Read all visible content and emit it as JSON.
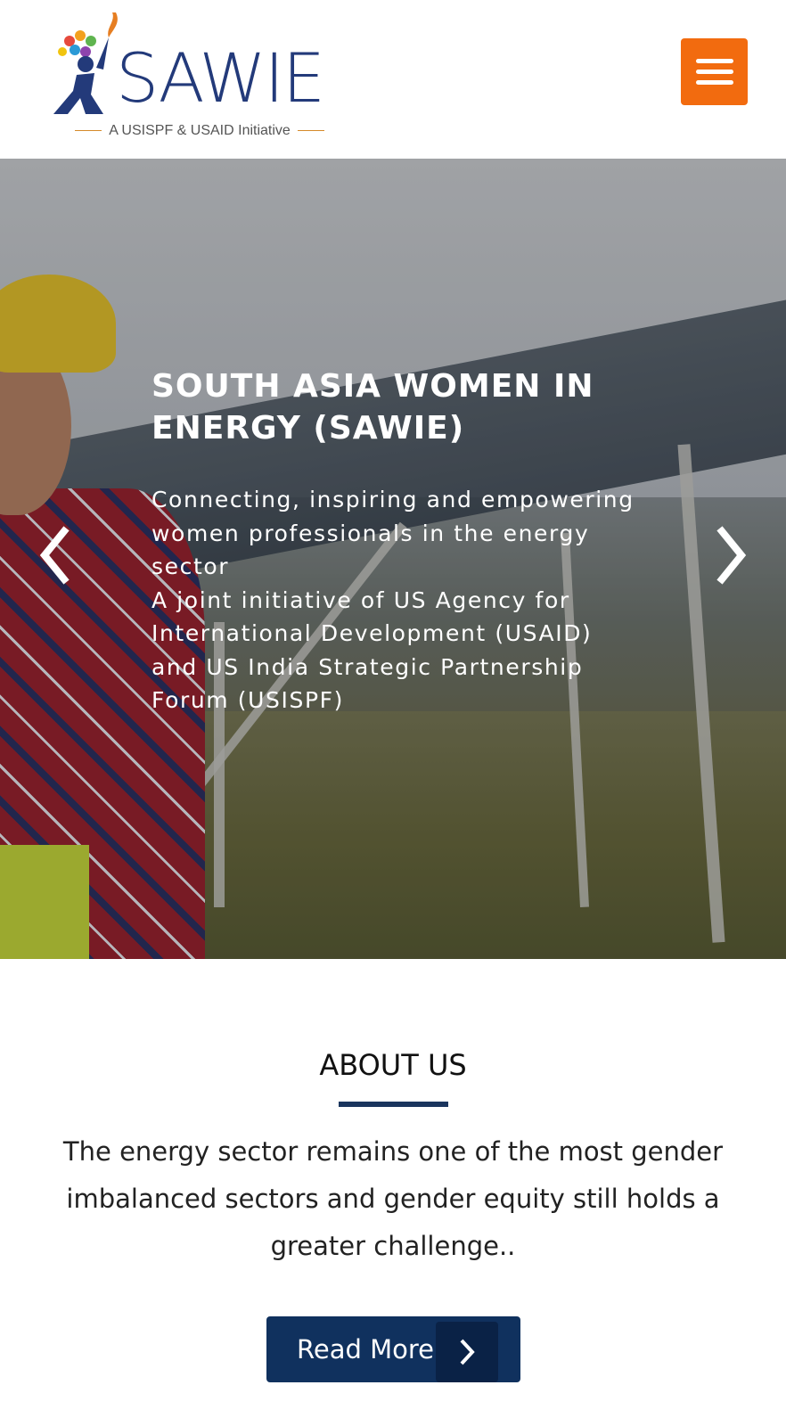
{
  "header": {
    "logo_text": "SAWIE",
    "logo_subtitle": "A USISPF & USAID Initiative",
    "menu_icon": "hamburger-icon",
    "menu_color": "#f26b0f"
  },
  "hero": {
    "title_line1": "SOUTH ASIA WOMEN IN",
    "title_line2": "ENERGY (SAWIE)",
    "desc_lines": [
      "Connecting, inspiring and empowering",
      "women professionals in the energy",
      "sector",
      "A joint initiative of US Agency for",
      "International Development (USAID)",
      "and US India Strategic Partnership",
      "Forum (USISPF)"
    ],
    "prev_icon": "chevron-left-icon",
    "next_icon": "chevron-right-icon"
  },
  "about": {
    "title": "ABOUT US",
    "text_lines": [
      "The energy sector remains one of the most gender",
      "imbalanced sectors and gender equity still holds a",
      "greater challenge.."
    ],
    "read_more_label": "Read More",
    "read_more_icon": "chevron-right-icon",
    "accent_color": "#10315e"
  }
}
